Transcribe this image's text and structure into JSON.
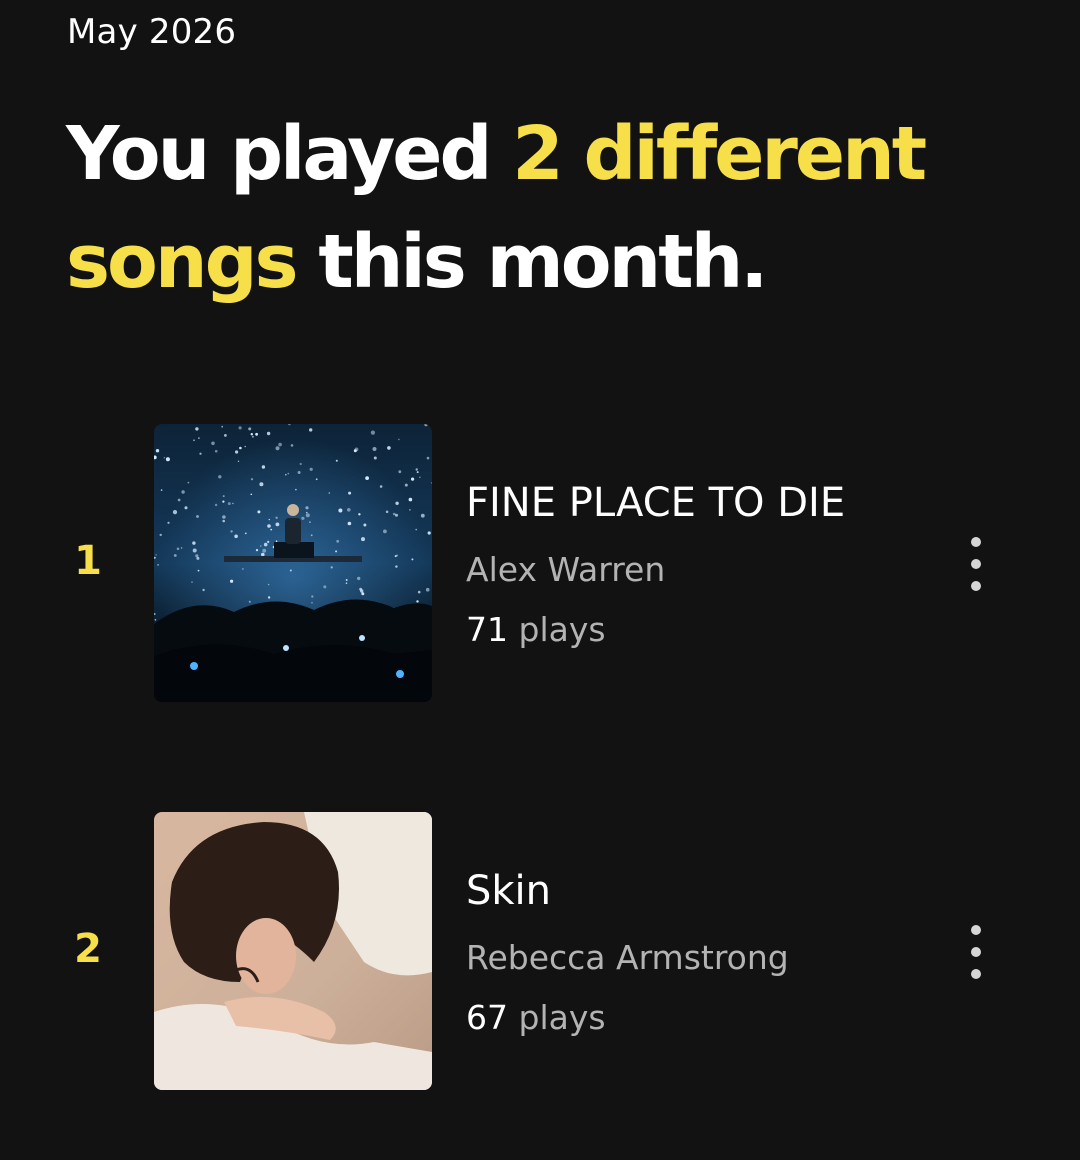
{
  "header": {
    "month": "May 2026",
    "headline": {
      "part1": "You played ",
      "highlight": "2 different songs",
      "part2": " this month."
    }
  },
  "colors": {
    "background": "#121212",
    "accent": "#f7df4a",
    "secondary_text": "#b3b3b3"
  },
  "songs": [
    {
      "rank": "1",
      "title": "FINE PLACE TO DIE",
      "artist": "Alex Warren",
      "play_count": "71",
      "play_unit": "plays",
      "menu_icon": "more-vertical-icon"
    },
    {
      "rank": "2",
      "title": "Skin",
      "artist": "Rebecca Armstrong",
      "play_count": "67",
      "play_unit": "plays",
      "menu_icon": "more-vertical-icon"
    }
  ]
}
